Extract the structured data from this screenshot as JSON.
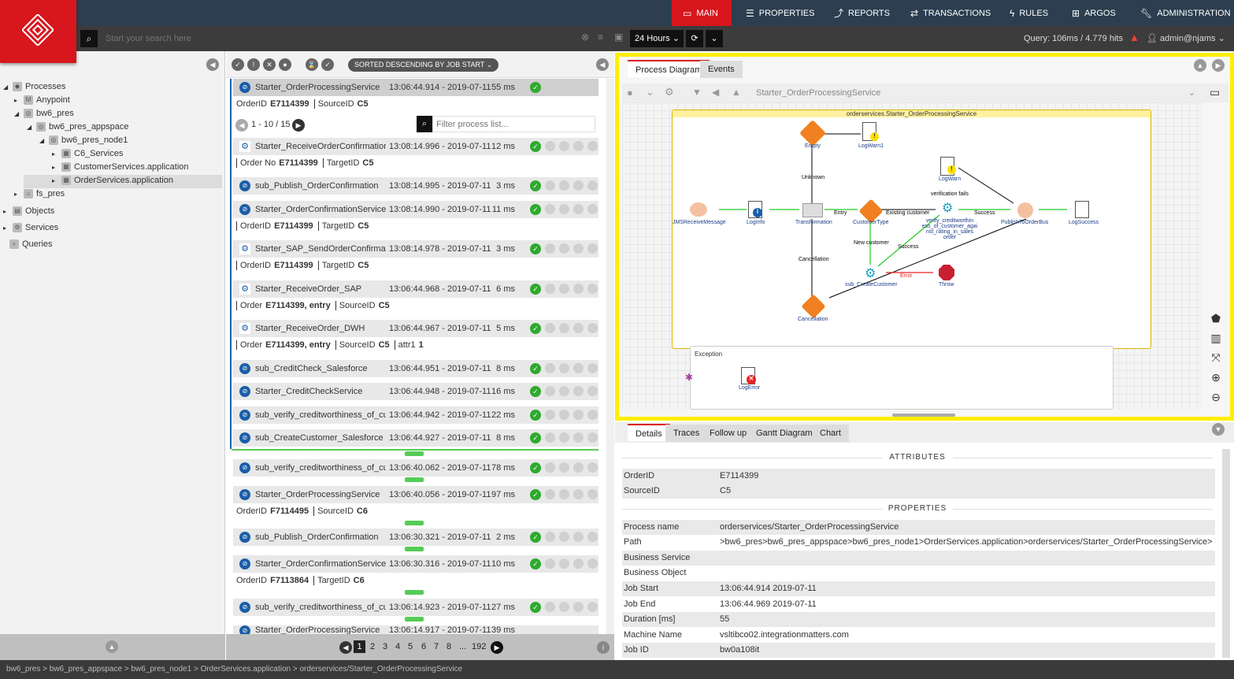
{
  "nav": {
    "items": [
      {
        "label": "MAIN",
        "icon": "monitor-icon"
      },
      {
        "label": "PROPERTIES",
        "icon": "list-icon"
      },
      {
        "label": "REPORTS",
        "icon": "chart-icon"
      },
      {
        "label": "TRANSACTIONS",
        "icon": "arrows-icon"
      },
      {
        "label": "RULES",
        "icon": "bolt-icon"
      },
      {
        "label": "ARGOS",
        "icon": "plus-box-icon"
      },
      {
        "label": "ADMINISTRATION",
        "icon": "wrench-icon"
      }
    ],
    "active_color": "#d7161e"
  },
  "search": {
    "placeholder": "Start your search here",
    "time_range": "24 Hours",
    "query_stats": "Query: 106ms / 4.779 hits",
    "user": "admin@njams"
  },
  "tree": {
    "processes": "Processes",
    "anypoint": "Anypoint",
    "bw6_pres": "bw6_pres",
    "appspace": "bw6_pres_appspace",
    "node1": "bw6_pres_node1",
    "c6": "C6_Services",
    "customer": "CustomerServices.application",
    "order": "OrderServices.application",
    "fs_pres": "fs_pres",
    "objects": "Objects",
    "services": "Services",
    "queries": "Queries"
  },
  "list": {
    "sort_label": "SORTED DESCENDING BY JOB START",
    "sub_range": "1 - 10 / 15",
    "filter_placeholder": "Filter process list...",
    "rows": [
      {
        "name": "Starter_OrderProcessingService",
        "time": "13:06:44.914 - 2019-07-11",
        "dur": "55 ms"
      },
      {
        "name": "Starter_ReceiveOrderConfirmation_C",
        "time": "13:08:14.996 - 2019-07-11",
        "dur": "12 ms"
      },
      {
        "name": "sub_Publish_OrderConfirmation",
        "time": "13:08:14.995 - 2019-07-11",
        "dur": "3 ms"
      },
      {
        "name": "Starter_OrderConfirmationService",
        "time": "13:08:14.990 - 2019-07-11",
        "dur": "11 ms"
      },
      {
        "name": "Starter_SAP_SendOrderConfirmatior",
        "time": "13:08:14.978 - 2019-07-11",
        "dur": "3 ms"
      },
      {
        "name": "Starter_ReceiveOrder_SAP",
        "time": "13:06:44.968 - 2019-07-11",
        "dur": "6 ms"
      },
      {
        "name": "Starter_ReceiveOrder_DWH",
        "time": "13:06:44.967 - 2019-07-11",
        "dur": "5 ms"
      },
      {
        "name": "sub_CreditCheck_Salesforce",
        "time": "13:06:44.951 - 2019-07-11",
        "dur": "8 ms"
      },
      {
        "name": "Starter_CreditCheckService",
        "time": "13:06:44.948 - 2019-07-11",
        "dur": "16 ms"
      },
      {
        "name": "sub_verify_creditworthiness_of_custo",
        "time": "13:06:44.942 - 2019-07-11",
        "dur": "22 ms"
      },
      {
        "name": "sub_CreateCustomer_Salesforce",
        "time": "13:06:44.927 - 2019-07-11",
        "dur": "8 ms"
      },
      {
        "name": "sub_verify_creditworthiness_of_custor",
        "time": "13:06:40.062 - 2019-07-11",
        "dur": "78 ms"
      },
      {
        "name": "Starter_OrderProcessingService",
        "time": "13:06:40.056 - 2019-07-11",
        "dur": "97 ms"
      },
      {
        "name": "sub_Publish_OrderConfirmation",
        "time": "13:06:30.321 - 2019-07-11",
        "dur": "2 ms"
      },
      {
        "name": "Starter_OrderConfirmationService",
        "time": "13:06:30.316 - 2019-07-11",
        "dur": "10 ms"
      },
      {
        "name": "sub_verify_creditworthiness_of_custor",
        "time": "13:06:14.923 - 2019-07-11",
        "dur": "27 ms"
      },
      {
        "name": "Starter_OrderProcessingService",
        "time": "13:06:14.917 - 2019-07-11",
        "dur": "39 ms"
      }
    ],
    "sub0": {
      "k1": "OrderID",
      "v1": "E7114399",
      "k2": "SourceID",
      "v2": "C5"
    },
    "sub1": {
      "k1": "Order No",
      "v1": "E7114399",
      "k2": "TargetID",
      "v2": "C5"
    },
    "sub3": {
      "k1": "OrderID",
      "v1": "E7114399",
      "k2": "TargetID",
      "v2": "C5"
    },
    "sub4": {
      "k1": "OrderID",
      "v1": "E7114399",
      "k2": "TargetID",
      "v2": "C5"
    },
    "sub5": {
      "k1": "Order",
      "v1": "E7114399, entry",
      "k2": "SourceID",
      "v2": "C5"
    },
    "sub6": {
      "k1": "Order",
      "v1": "E7114399, entry",
      "k2": "SourceID",
      "v2": "C5",
      "k3": "attr1",
      "v3": "1"
    },
    "sub12": {
      "k1": "OrderID",
      "v1": "F7114495",
      "k2": "SourceID",
      "v2": "C6"
    },
    "sub14": {
      "k1": "OrderID",
      "v1": "F7113864",
      "k2": "TargetID",
      "v2": "C6"
    },
    "pages": [
      "1",
      "2",
      "3",
      "4",
      "5",
      "6",
      "7",
      "8",
      "...",
      "192"
    ]
  },
  "diagram": {
    "tabs": [
      "Process Diagram",
      "Events"
    ],
    "process_select": "Starter_OrderProcessingService",
    "box_title": "orderservices.Starter_OrderProcessingService",
    "exception_label": "Exception",
    "activities": {
      "empty": "Empty",
      "logwarn1": "LogWarn1",
      "logwarn": "LogWarn",
      "jms": "JMSReceiveMessage",
      "loginfo": "LogInfo",
      "transformation": "Transformation",
      "customertype": "CustomerType",
      "verify": "verify_creditworthin ess_of_customer_agai nst_rating_in_sales order",
      "publish": "PublishToOrderBus",
      "logsuccess": "LogSuccess",
      "subcreate": "sub_CreateCustomer",
      "throw": "Throw",
      "cancellation": "Cancellation",
      "logerror": "LogError"
    },
    "edges": {
      "unknown": "Unknown",
      "entry": "Entry",
      "existing": "Existing customer",
      "verif": "verification fails",
      "success1": "Success",
      "newcust": "New customer",
      "success2": "Success",
      "cancel": "Cancellation",
      "error": "Error"
    }
  },
  "details": {
    "tabs": [
      "Details",
      "Traces",
      "Follow up",
      "Gantt Diagram",
      "Chart"
    ],
    "attributes_title": "ATTRIBUTES",
    "properties_title": "PROPERTIES",
    "attributes": [
      {
        "k": "OrderID",
        "v": "E7114399"
      },
      {
        "k": "SourceID",
        "v": "C5"
      }
    ],
    "properties": [
      {
        "k": "Process name",
        "v": "orderservices/Starter_OrderProcessingService"
      },
      {
        "k": "Path",
        "v": ">bw6_pres>bw6_pres_appspace>bw6_pres_node1>OrderServices.application>orderservices/Starter_OrderProcessingService>"
      },
      {
        "k": "Business Service",
        "v": ""
      },
      {
        "k": "Business Object",
        "v": ""
      },
      {
        "k": "Job Start",
        "v": "13:06:44.914  2019-07-11"
      },
      {
        "k": "Job End",
        "v": "13:06:44.969  2019-07-11"
      },
      {
        "k": "Duration [ms]",
        "v": "55"
      },
      {
        "k": "Machine Name",
        "v": "vsltibco02.integrationmatters.com"
      },
      {
        "k": "Job ID",
        "v": "bw0a108it"
      }
    ]
  },
  "statusbar": "bw6_pres > bw6_pres_appspace > bw6_pres_node1 > OrderServices.application > orderservices/Starter_OrderProcessingService"
}
